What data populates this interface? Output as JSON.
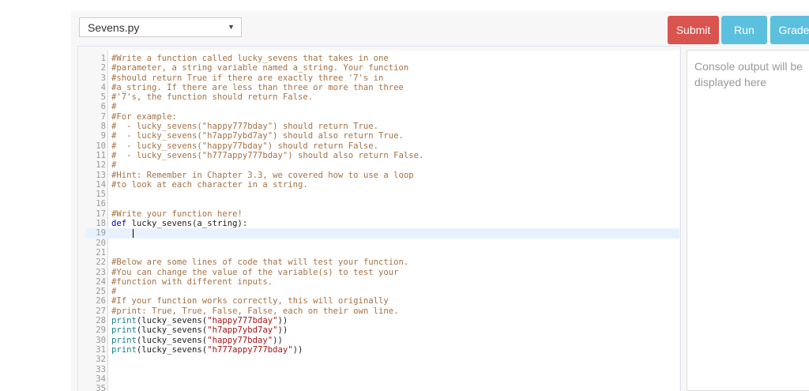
{
  "file_select": {
    "value": "Sevens.py"
  },
  "buttons": {
    "submit": "Submit",
    "run": "Run",
    "grade": "Grade"
  },
  "console": {
    "placeholder": "Console output will be displayed here"
  },
  "editor": {
    "active_line": 19,
    "lines": [
      [
        [
          "comment",
          "#Write a function called lucky_sevens that takes in one"
        ]
      ],
      [
        [
          "comment",
          "#parameter, a string variable named a_string. Your function"
        ]
      ],
      [
        [
          "comment",
          "#should return True if there are exactly three '7's in"
        ]
      ],
      [
        [
          "comment",
          "#a_string. If there are less than three or more than three"
        ]
      ],
      [
        [
          "comment",
          "#'7's, the function should return False."
        ]
      ],
      [
        [
          "comment",
          "#"
        ]
      ],
      [
        [
          "comment",
          "#For example:"
        ]
      ],
      [
        [
          "comment",
          "#  - lucky_sevens(\"happy777bday\") should return True."
        ]
      ],
      [
        [
          "comment",
          "#  - lucky_sevens(\"h7app7ybd7ay\") should also return True."
        ]
      ],
      [
        [
          "comment",
          "#  - lucky_sevens(\"happy77bday\") should return False."
        ]
      ],
      [
        [
          "comment",
          "#  - lucky_sevens(\"h777appy777bday\") should also return False."
        ]
      ],
      [
        [
          "comment",
          "#"
        ]
      ],
      [
        [
          "comment",
          "#Hint: Remember in Chapter 3.3, we covered how to use a loop"
        ]
      ],
      [
        [
          "comment",
          "#to look at each character in a string."
        ]
      ],
      [],
      [],
      [
        [
          "comment",
          "#Write your function here!"
        ]
      ],
      [
        [
          "kw",
          "def"
        ],
        [
          "plain",
          " lucky_sevens(a_string):"
        ]
      ],
      [
        [
          "plain",
          "    "
        ]
      ],
      [],
      [],
      [
        [
          "comment",
          "#Below are some lines of code that will test your function."
        ]
      ],
      [
        [
          "comment",
          "#You can change the value of the variable(s) to test your"
        ]
      ],
      [
        [
          "comment",
          "#function with different inputs."
        ]
      ],
      [
        [
          "comment",
          "#"
        ]
      ],
      [
        [
          "comment",
          "#If your function works correctly, this will originally"
        ]
      ],
      [
        [
          "comment",
          "#print: True, True, False, False, each on their own line."
        ]
      ],
      [
        [
          "builtin",
          "print"
        ],
        [
          "plain",
          "(lucky_sevens("
        ],
        [
          "str",
          "\"happy777bday\""
        ],
        [
          "plain",
          "))"
        ]
      ],
      [
        [
          "builtin",
          "print"
        ],
        [
          "plain",
          "(lucky_sevens("
        ],
        [
          "str",
          "\"h7app7ybd7ay\""
        ],
        [
          "plain",
          "))"
        ]
      ],
      [
        [
          "builtin",
          "print"
        ],
        [
          "plain",
          "(lucky_sevens("
        ],
        [
          "str",
          "\"happy77bday\""
        ],
        [
          "plain",
          "))"
        ]
      ],
      [
        [
          "builtin",
          "print"
        ],
        [
          "plain",
          "(lucky_sevens("
        ],
        [
          "str",
          "\"h777appy777bday\""
        ],
        [
          "plain",
          "))"
        ]
      ],
      [],
      [],
      [],
      []
    ]
  }
}
